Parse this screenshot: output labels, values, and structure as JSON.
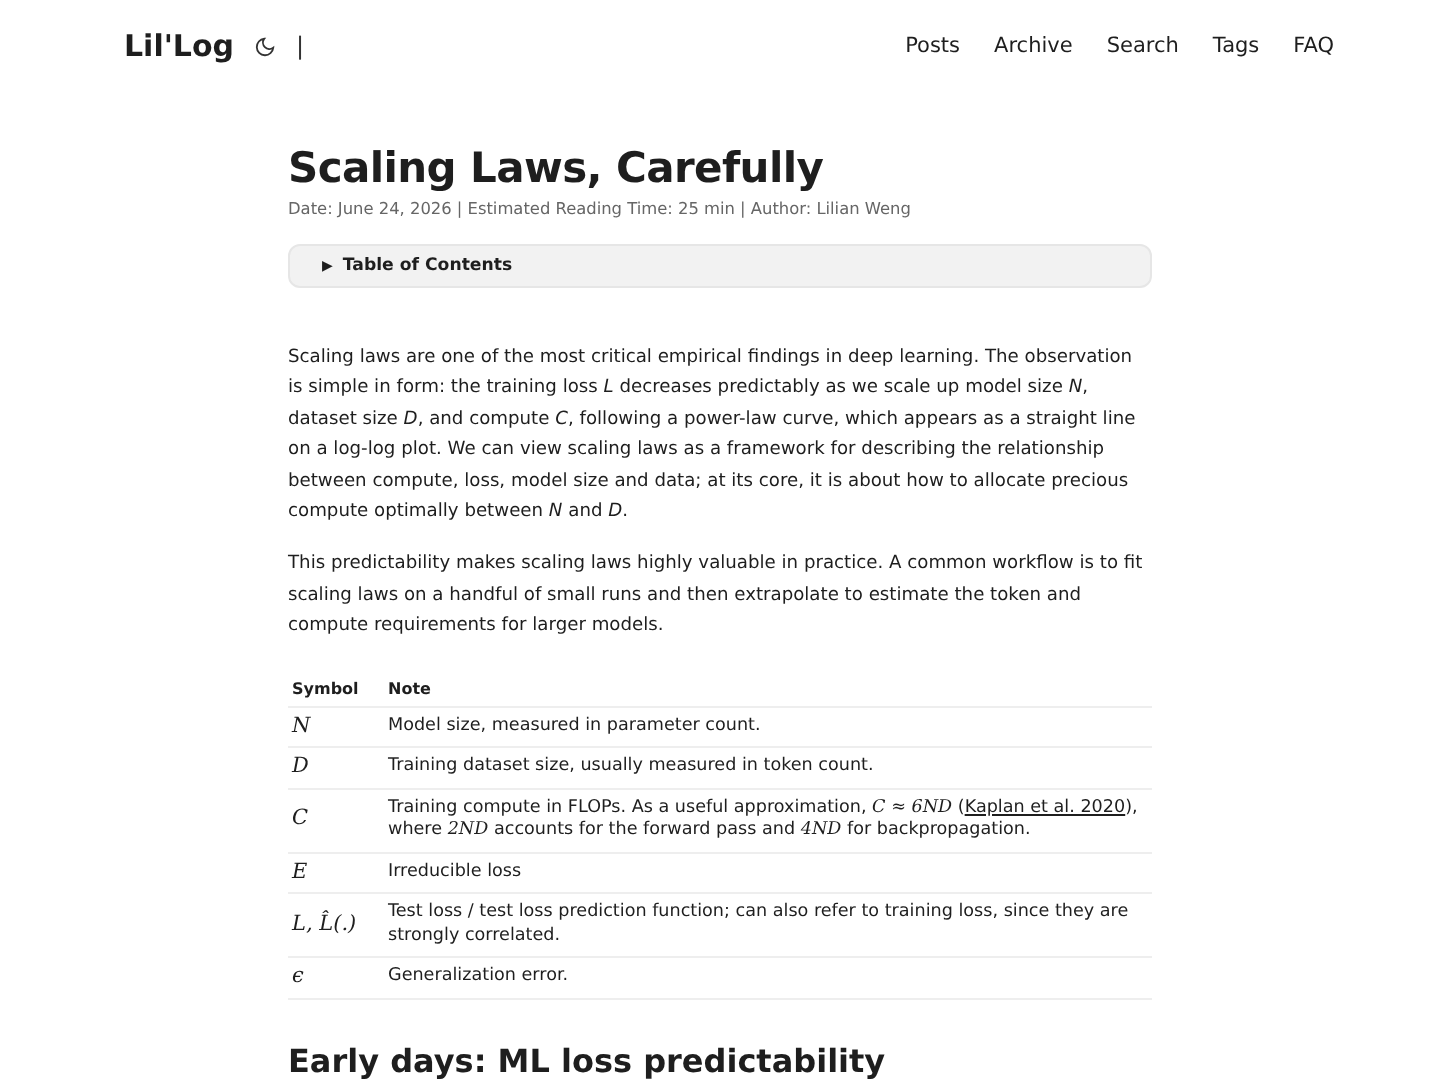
{
  "header": {
    "logo": "Lil'Log",
    "separator": "|",
    "nav": [
      {
        "label": "Posts"
      },
      {
        "label": "Archive"
      },
      {
        "label": "Search"
      },
      {
        "label": "Tags"
      },
      {
        "label": "FAQ"
      }
    ]
  },
  "post": {
    "title": "Scaling Laws, Carefully",
    "meta": "Date: June 24, 2026 | Estimated Reading Time: 25 min | Author: Lilian Weng",
    "toc": {
      "marker": "▶",
      "label": "Table of Contents",
      "expanded": false
    },
    "paragraphs": [
      "Scaling laws are one of the most critical empirical findings in deep learning. The observation is simple in form: the training loss *L* decreases predictably as we scale up model size *N*, dataset size *D*, and compute *C*, following a power-law curve, which appears as a straight line on a log-log plot. We can view scaling laws as a framework for describing the relationship between compute, loss, model size and data; at its core, it is about how to allocate precious compute optimally between *N* and *D*.",
      "This predictability makes scaling laws highly valuable in practice. A common workflow is to fit scaling laws on a handful of small runs and then extrapolate to estimate the token and compute requirements for larger models."
    ],
    "table": {
      "columns": [
        "Symbol",
        "Note"
      ],
      "rows": [
        {
          "symbol": "N",
          "note": [
            {
              "text": "Model size, measured in parameter count."
            }
          ]
        },
        {
          "symbol": "D",
          "note": [
            {
              "text": "Training dataset size, usually measured in token count."
            }
          ]
        },
        {
          "symbol": "C",
          "note": [
            {
              "text": "Training compute in FLOPs. As a useful approximation, "
            },
            {
              "text": "C ≈ 6ND",
              "kind": "math"
            },
            {
              "text": " ("
            },
            {
              "text": "Kaplan et al. 2020",
              "kind": "link"
            },
            {
              "text": "), where "
            },
            {
              "text": "2ND",
              "kind": "math"
            },
            {
              "text": " accounts for the forward pass and "
            },
            {
              "text": "4ND",
              "kind": "math"
            },
            {
              "text": " for backpropagation."
            }
          ]
        },
        {
          "symbol": "E",
          "note": [
            {
              "text": "Irreducible loss"
            }
          ]
        },
        {
          "symbol": "L, L̂(.)",
          "note": [
            {
              "text": "Test loss / test loss prediction function; can also refer to training loss, since they are strongly correlated."
            }
          ]
        },
        {
          "symbol": "ϵ",
          "note": [
            {
              "text": "Generalization error."
            }
          ]
        }
      ]
    },
    "section_heading": "Early days: ML loss predictability"
  }
}
